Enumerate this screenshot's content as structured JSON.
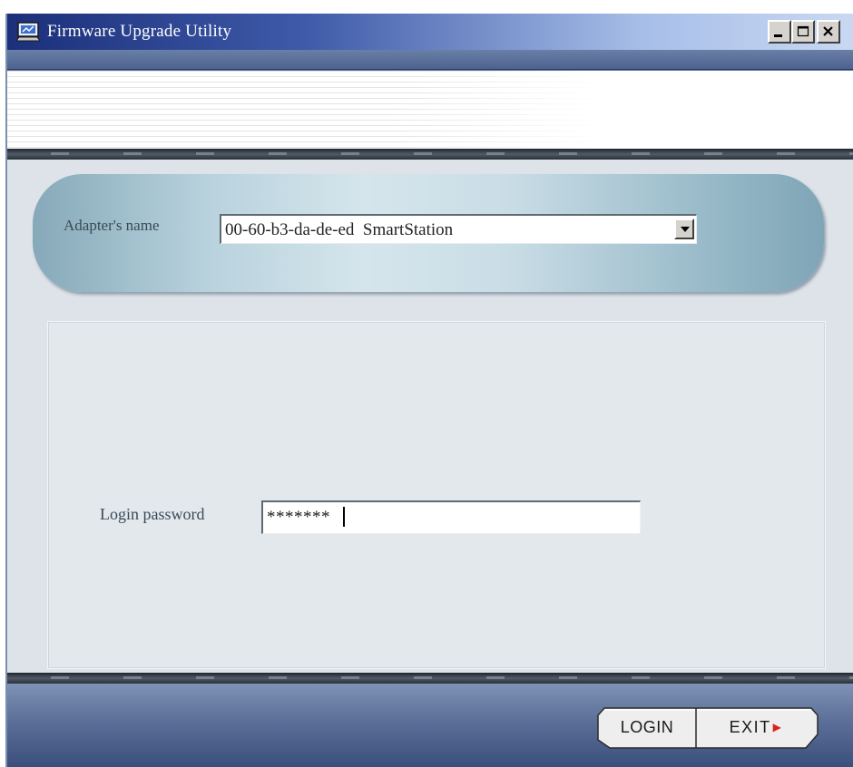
{
  "window": {
    "title": "Firmware Upgrade Utility"
  },
  "adapter": {
    "label": "Adapter's name",
    "selected": "00-60-b3-da-de-ed  SmartStation"
  },
  "login": {
    "label": "Login password",
    "value": "*******"
  },
  "buttons": {
    "login_label": "LOGIN",
    "exit_label": "EXIT"
  },
  "icons": {
    "app": "laptop-icon",
    "minimize": "minimize-icon",
    "maximize": "maximize-icon",
    "close": "close-icon",
    "dropdown": "chevron-down-icon",
    "exit_arrow": "play-arrow-icon"
  },
  "colors": {
    "titlebar_start": "#1b2f7a",
    "titlebar_end": "#c9d8f2",
    "panel": "#dde3e9",
    "bottom_bar": "#5b6f98",
    "exit_arrow": "#e02020"
  }
}
